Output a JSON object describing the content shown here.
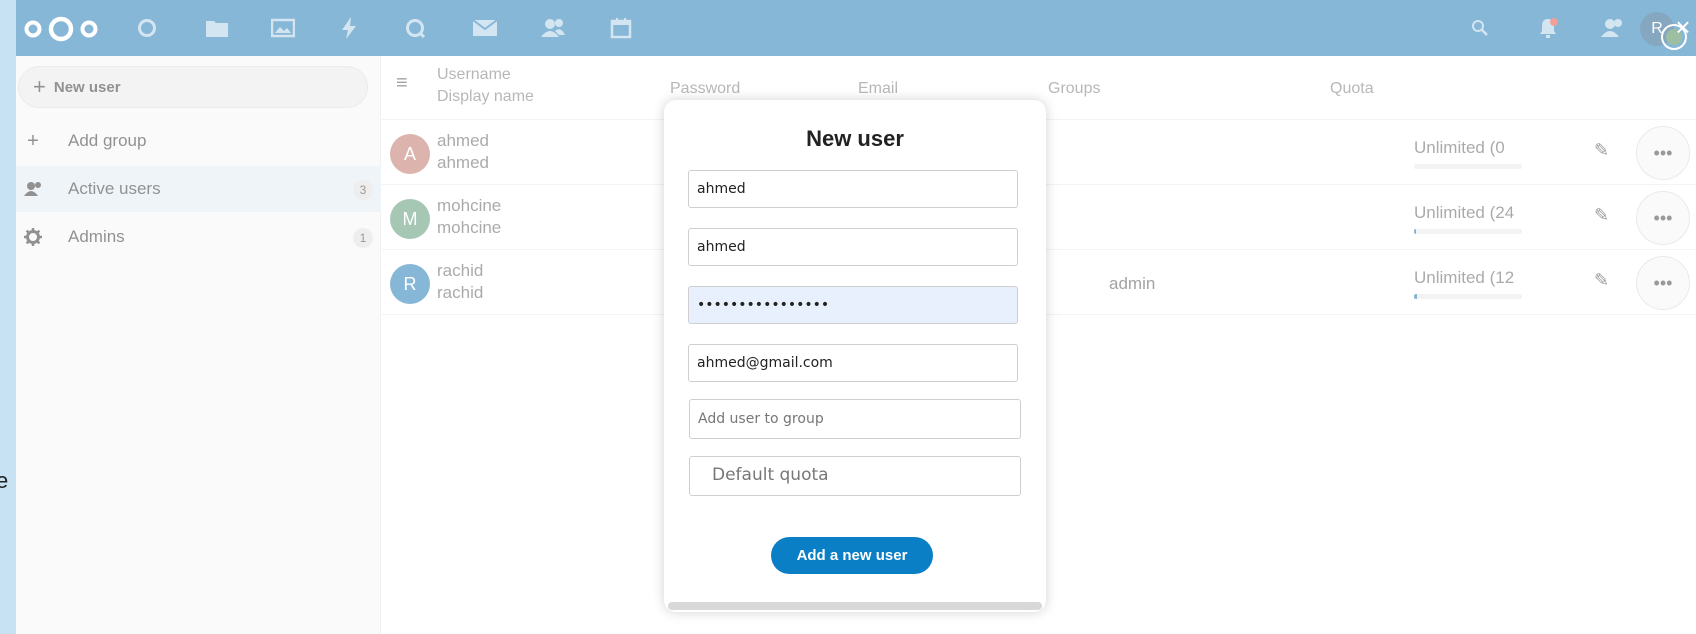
{
  "header": {
    "avatar_initials": "R",
    "accent_color": "#0f6fad",
    "apps": [
      "dashboard-icon",
      "files-icon",
      "photos-icon",
      "activity-icon",
      "talk-icon",
      "mail-icon",
      "contacts-icon",
      "calendar-icon"
    ]
  },
  "sidebar": {
    "new_user_label": "New user",
    "add_group_label": "Add group",
    "items": [
      {
        "label": "Active users",
        "count": "3"
      },
      {
        "label": "Admins",
        "count": "1"
      }
    ]
  },
  "table": {
    "headers": {
      "username": "Username",
      "display_name": "Display name",
      "password": "Password",
      "email": "Email",
      "groups": "Groups",
      "quota": "Quota"
    },
    "rows": [
      {
        "initial": "A",
        "username": "ahmed",
        "display_name": "ahmed",
        "group": "",
        "quota": "Unlimited (0",
        "quota_fraction": 0.0,
        "avatar_color": "#b8685a"
      },
      {
        "initial": "M",
        "username": "mohcine",
        "display_name": "mohcine",
        "group": "",
        "quota": "Unlimited (24",
        "quota_fraction": 0.02,
        "avatar_color": "#4f8f6a"
      },
      {
        "initial": "R",
        "username": "rachid",
        "display_name": "rachid",
        "group": "admin",
        "quota": "Unlimited (12",
        "quota_fraction": 0.03,
        "avatar_color": "#0f6fad"
      }
    ]
  },
  "modal": {
    "title": "New user",
    "username_value": "ahmed",
    "display_name_value": "ahmed",
    "password_value": "••••••••••••••••",
    "email_value": "ahmed@gmail.com",
    "group_placeholder": "Add user to group",
    "quota_placeholder": "Default quota",
    "submit_label": "Add a new user"
  },
  "edge_glyph": "e"
}
